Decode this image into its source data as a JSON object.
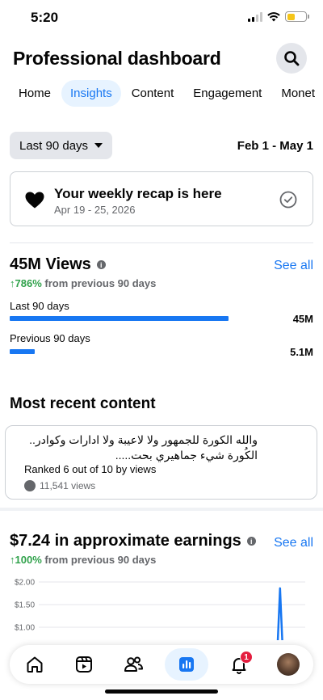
{
  "status_bar": {
    "time": "5:20"
  },
  "header": {
    "title": "Professional dashboard"
  },
  "tabs": [
    {
      "label": "Home"
    },
    {
      "label": "Insights",
      "active": true
    },
    {
      "label": "Content"
    },
    {
      "label": "Engagement"
    },
    {
      "label": "Monet"
    }
  ],
  "filters": {
    "period": "Last 90 days",
    "date_range": "Feb 1 - May 1"
  },
  "recap": {
    "title": "Your weekly recap is here",
    "date": "Apr 19 - 25, 2026"
  },
  "views": {
    "title": "45M Views",
    "see_all": "See all",
    "growth_pct": "↑786%",
    "growth_text": "from previous 90 days",
    "bars": [
      {
        "label": "Last 90 days",
        "value": "45M",
        "fraction": 0.82
      },
      {
        "label": "Previous 90 days",
        "value": "5.1M",
        "fraction": 0.093
      }
    ]
  },
  "recent": {
    "title": "Most recent content",
    "text": "والله الكورة للجمهور ولا لاعيبة ولا ادارات وكوادر.. الكُورة شيء جماهيري بحت.....",
    "rank": "Ranked 6 out of 10 by views",
    "views": "11,541 views"
  },
  "earnings": {
    "title": "$7.24 in approximate earnings",
    "see_all": "See all",
    "growth_pct": "↑100%",
    "growth_text": "from previous 90 days"
  },
  "chart_data": {
    "type": "line",
    "y_ticks": [
      "$2.00",
      "$1.50",
      "$1.00"
    ],
    "ylim": [
      1.0,
      2.0
    ],
    "series": [
      {
        "values": [
          0,
          0,
          0,
          0,
          0,
          0,
          0,
          0,
          0,
          0,
          0,
          0,
          0,
          0,
          0,
          0,
          0,
          0,
          0,
          0,
          0,
          0,
          0,
          0,
          0,
          0,
          0,
          0,
          0,
          0,
          0,
          0,
          0,
          0,
          0,
          0,
          0,
          0,
          0,
          0,
          0,
          0,
          0,
          0,
          0,
          0,
          0,
          0,
          0,
          0,
          0,
          0,
          0,
          0,
          0,
          0,
          0,
          0,
          0,
          0,
          0,
          0,
          0,
          0,
          0,
          0,
          0,
          0,
          0,
          0,
          0,
          0,
          0,
          0,
          0,
          0,
          0,
          0,
          0,
          0,
          0,
          0,
          0,
          1.86,
          0,
          0,
          0,
          0,
          0,
          0,
          0
        ]
      }
    ],
    "color": "#1877f2"
  },
  "nav": {
    "items": [
      {
        "icon": "home-icon"
      },
      {
        "icon": "video-icon"
      },
      {
        "icon": "friends-icon"
      },
      {
        "icon": "insights-icon",
        "active": true
      },
      {
        "icon": "bell-icon",
        "badge": "1"
      },
      {
        "icon": "avatar"
      }
    ]
  }
}
